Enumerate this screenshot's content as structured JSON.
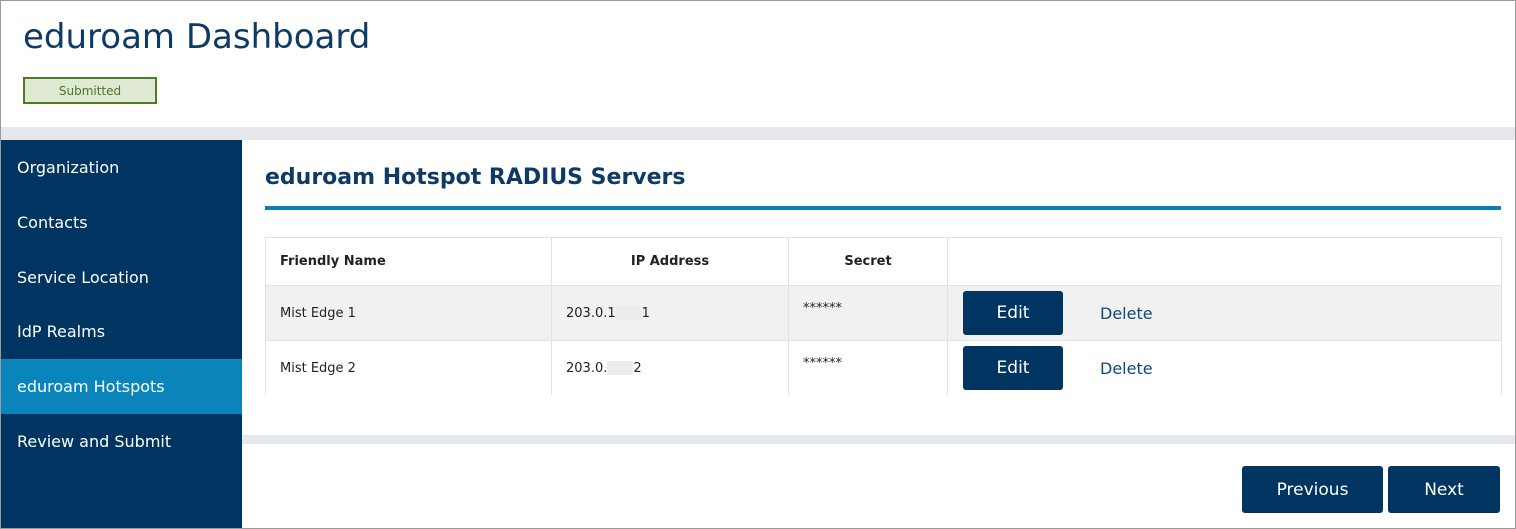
{
  "header": {
    "title": "eduroam Dashboard",
    "status": "Submitted"
  },
  "sidebar": {
    "items": [
      {
        "label": "Organization",
        "active": false
      },
      {
        "label": "Contacts",
        "active": false
      },
      {
        "label": "Service Location",
        "active": false
      },
      {
        "label": "IdP Realms",
        "active": false
      },
      {
        "label": "eduroam Hotspots",
        "active": true
      },
      {
        "label": "Review and Submit",
        "active": false
      }
    ]
  },
  "main": {
    "section_title": "eduroam Hotspot RADIUS Servers",
    "table": {
      "columns": [
        "Friendly Name",
        "IP Address",
        "Secret",
        ""
      ],
      "rows": [
        {
          "friendly_name": "Mist Edge 1",
          "ip_prefix": "203.0.1",
          "ip_suffix": "1",
          "secret": "******",
          "edit_label": "Edit",
          "delete_label": "Delete"
        },
        {
          "friendly_name": "Mist Edge 2",
          "ip_prefix": "203.0.",
          "ip_suffix": "2",
          "secret": "******",
          "edit_label": "Edit",
          "delete_label": "Delete"
        }
      ]
    },
    "buttons": {
      "previous": "Previous",
      "next": "Next"
    }
  },
  "colors": {
    "navy": "#003562",
    "active_blue": "#0a85bb",
    "badge_green": "#4d7d1e"
  }
}
